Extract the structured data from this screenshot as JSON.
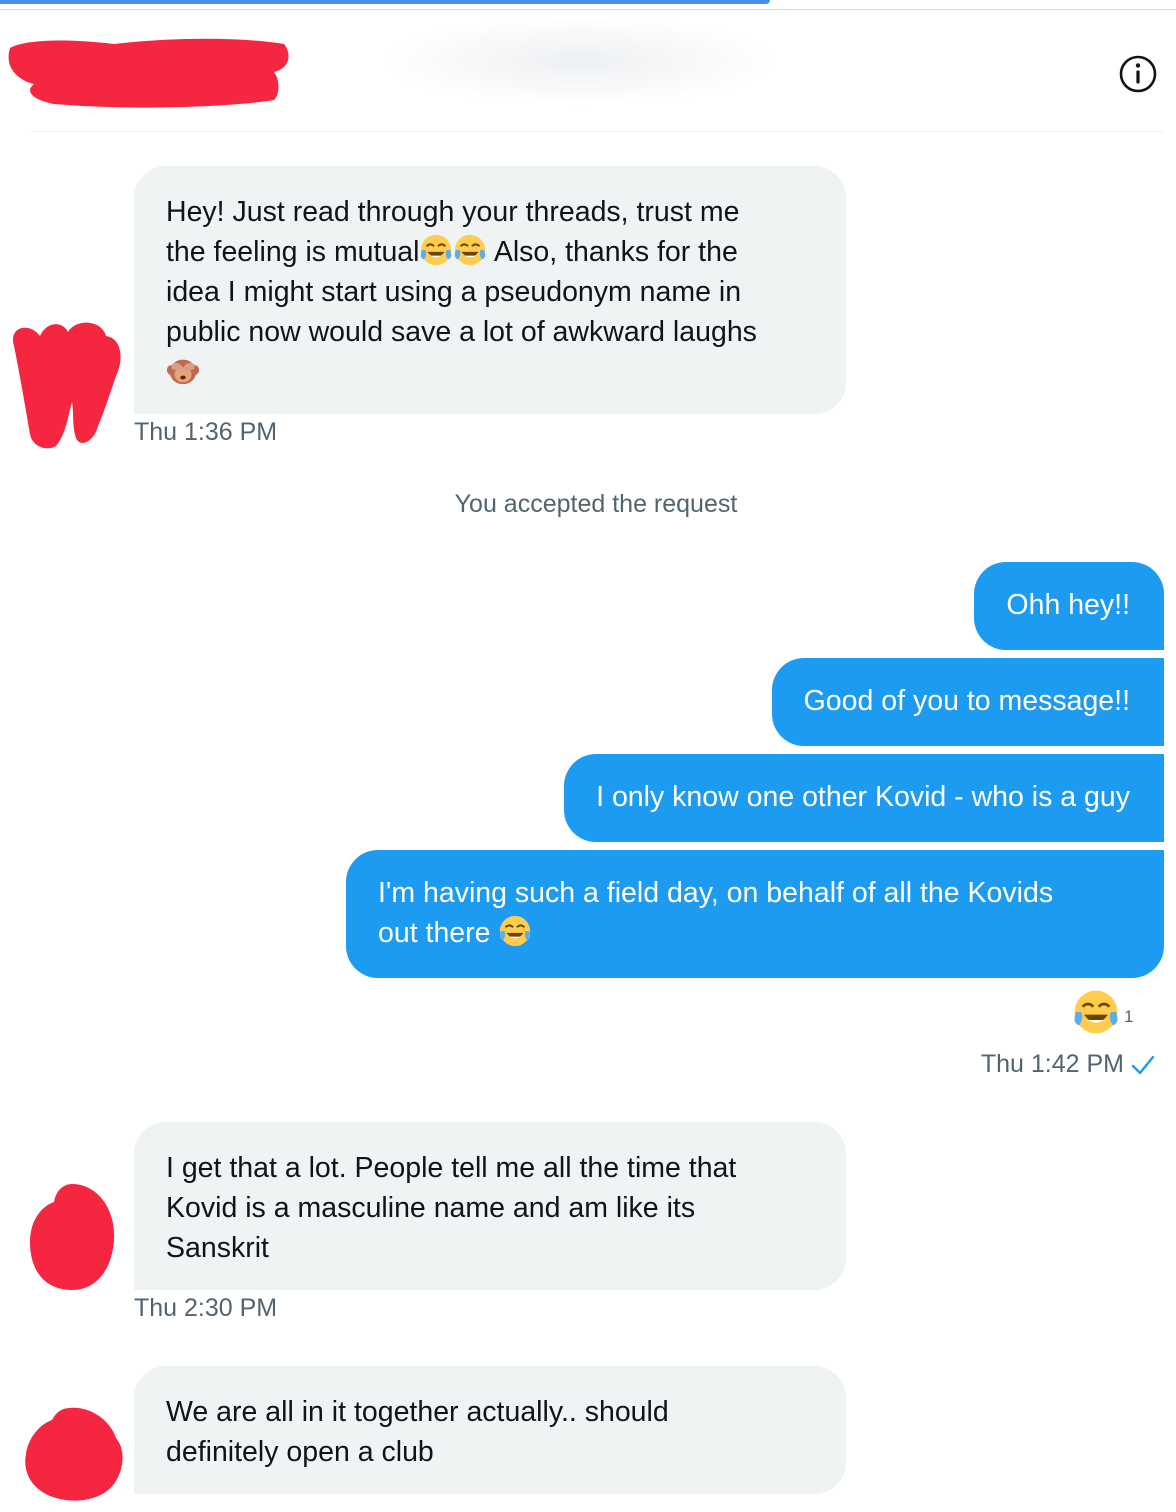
{
  "header": {
    "name_redacted": true,
    "info_icon": "info-icon"
  },
  "messages": [
    {
      "direction": "in",
      "text_lines": [
        "Hey! Just read through your threads, trust me",
        "the feeling is mutual",
        "Also, thanks for the",
        "idea I might start using a pseudonym name in",
        "public now would save a lot of awkward  laughs"
      ],
      "emojis": [
        "tears-of-joy-emoji",
        "tears-of-joy-emoji",
        "see-no-evil-monkey-emoji"
      ],
      "timestamp": "Thu 1:36 PM"
    },
    {
      "direction": "system",
      "text": "You accepted the request"
    },
    {
      "direction": "out",
      "text": "Ohh hey!!"
    },
    {
      "direction": "out",
      "text": "Good of you to message!!"
    },
    {
      "direction": "out",
      "text": "I only know one other Kovid - who is a guy"
    },
    {
      "direction": "out",
      "text_line1": "I'm having such a field day, on behalf of all the Kovids",
      "text_line2": "out there",
      "emoji": "tears-of-joy-emoji",
      "reaction": {
        "emoji": "tears-of-joy-emoji",
        "count": "1"
      },
      "timestamp": "Thu 1:42 PM",
      "read_icon": "check-icon"
    },
    {
      "direction": "in",
      "text_lines": [
        "I get that a lot. People tell me all the time that",
        "Kovid is a masculine name and am like its",
        "Sanskrit"
      ],
      "timestamp": "Thu 2:30 PM"
    },
    {
      "direction": "in",
      "text_lines": [
        "We are all in it together actually.. should",
        "definitely open a club"
      ]
    }
  ],
  "colors": {
    "outgoing_bubble": "#1d9bf0",
    "incoming_bubble": "#eff3f4",
    "redaction": "#f5263f",
    "muted_text": "#536471",
    "top_accent": "#4a8fe8"
  }
}
